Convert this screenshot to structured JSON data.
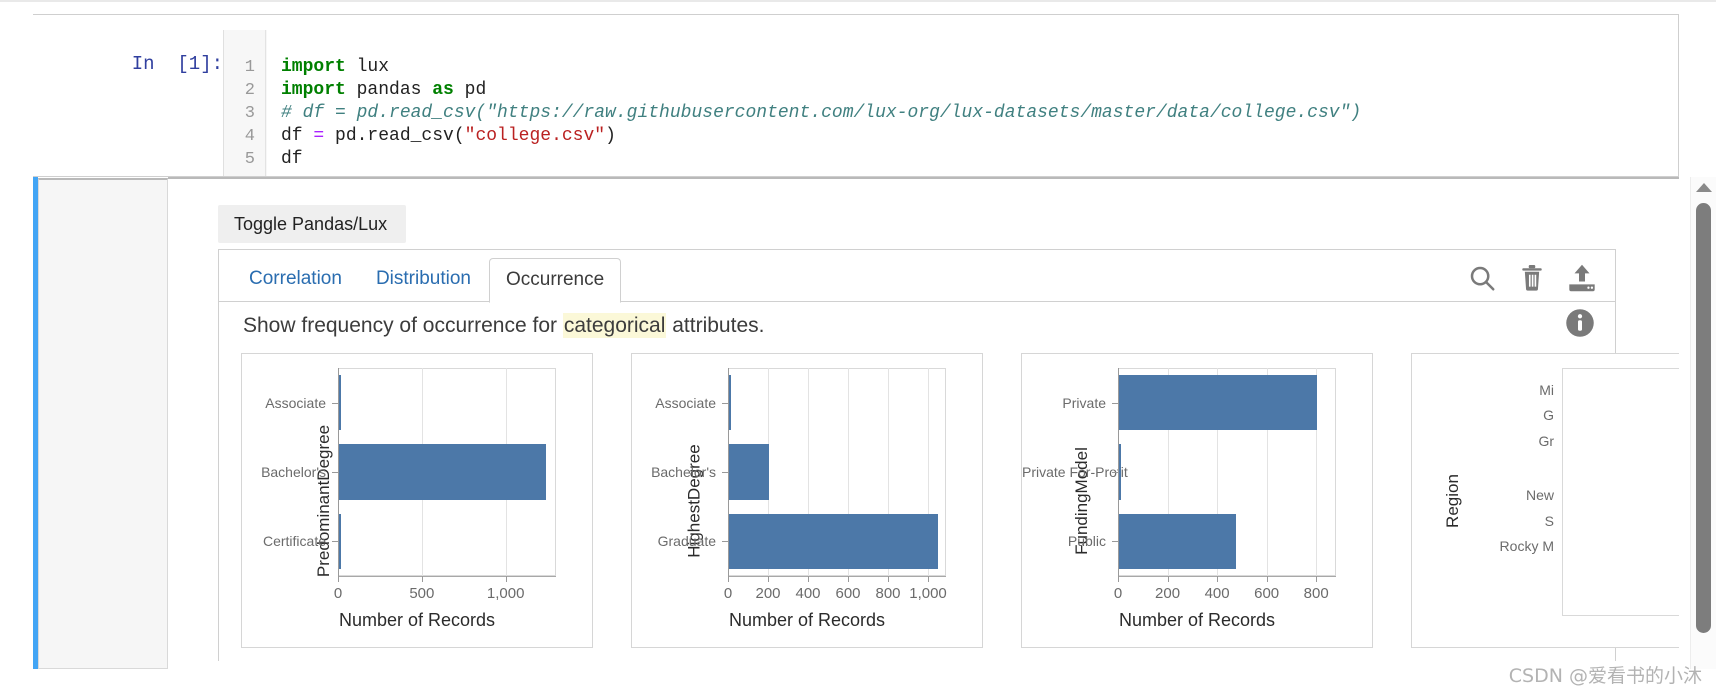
{
  "notebook": {
    "prompt_label": "In  [1]:",
    "line_numbers": [
      "1",
      "2",
      "3",
      "4",
      "5"
    ],
    "code": [
      {
        "tokens": [
          {
            "t": "import",
            "c": "kw"
          },
          {
            "t": " lux",
            "c": "pl"
          }
        ]
      },
      {
        "tokens": [
          {
            "t": "import",
            "c": "kw"
          },
          {
            "t": " pandas ",
            "c": "pl"
          },
          {
            "t": "as",
            "c": "kw"
          },
          {
            "t": " pd",
            "c": "pl"
          }
        ]
      },
      {
        "tokens": [
          {
            "t": "# df = pd.read_csv(\"https://raw.githubusercontent.com/lux-org/lux-datasets/master/data/college.csv\")",
            "c": "cmt"
          }
        ]
      },
      {
        "tokens": [
          {
            "t": "df ",
            "c": "pl"
          },
          {
            "t": "=",
            "c": "op"
          },
          {
            "t": " pd.read_csv(",
            "c": "pl"
          },
          {
            "t": "\"college.csv\"",
            "c": "str"
          },
          {
            "t": ")",
            "c": "pl"
          }
        ]
      },
      {
        "tokens": [
          {
            "t": "df",
            "c": "pl"
          }
        ]
      }
    ]
  },
  "output": {
    "toggle_button_label": "Toggle Pandas/Lux",
    "tabs": [
      {
        "label": "Correlation",
        "active": false
      },
      {
        "label": "Distribution",
        "active": false
      },
      {
        "label": "Occurrence",
        "active": true
      }
    ],
    "toolbar_icons": [
      {
        "name": "search-icon",
        "title": "Search"
      },
      {
        "name": "trash-icon",
        "title": "Delete"
      },
      {
        "name": "upload-icon",
        "title": "Export"
      }
    ],
    "description": {
      "prefix": "Show frequency of occurrence for ",
      "highlight": "categorical",
      "suffix": " attributes."
    },
    "info_icon": {
      "name": "info-icon",
      "title": "Info"
    }
  },
  "scrollbar": {
    "up_arrow": "scroll-up-arrow",
    "thumb": "scroll-thumb"
  },
  "watermark": "CSDN @爱看书的小沐",
  "colors": {
    "bar": "#4c78a8",
    "accent": "#42a5f5",
    "tab_link": "#2a6db0",
    "highlight": "#fbf8d8"
  },
  "chart_data": [
    {
      "type": "bar",
      "orientation": "horizontal",
      "title": "",
      "ylabel": "PredominantDegree",
      "xlabel": "Number of Records",
      "categories": [
        "Associate",
        "Bachelor's",
        "Certificate"
      ],
      "values": [
        20,
        1240,
        2
      ],
      "xticks": [
        0,
        500,
        1000
      ],
      "xtick_labels": [
        "0",
        "500",
        "1,000"
      ],
      "xlim": [
        0,
        1300
      ],
      "grid": true,
      "legend": "none"
    },
    {
      "type": "bar",
      "orientation": "horizontal",
      "title": "",
      "ylabel": "HighestDegree",
      "xlabel": "Number of Records",
      "categories": [
        "Associate",
        "Bachelor's",
        "Graduate"
      ],
      "values": [
        10,
        205,
        1050
      ],
      "xticks": [
        0,
        200,
        400,
        600,
        800,
        1000
      ],
      "xtick_labels": [
        "0",
        "200",
        "400",
        "600",
        "800",
        "1,000"
      ],
      "xlim": [
        0,
        1090
      ],
      "grid": true,
      "legend": "none"
    },
    {
      "type": "bar",
      "orientation": "horizontal",
      "title": "",
      "ylabel": "FundingModel",
      "xlabel": "Number of Records",
      "categories": [
        "Private",
        "Private For-Profit",
        "Public"
      ],
      "values": [
        805,
        4,
        475
      ],
      "xticks": [
        0,
        200,
        400,
        600,
        800
      ],
      "xtick_labels": [
        "0",
        "200",
        "400",
        "600",
        "800"
      ],
      "xlim": [
        0,
        880
      ],
      "grid": true,
      "legend": "none"
    },
    {
      "type": "bar",
      "orientation": "horizontal",
      "title": "",
      "ylabel": "Region",
      "xlabel": "",
      "categories": [
        "Mi",
        "G",
        "Gr",
        "New",
        "S",
        "Rocky M"
      ],
      "values": [],
      "xticks": [],
      "xtick_labels": [],
      "grid": true,
      "legend": "none",
      "clipped": true
    }
  ]
}
